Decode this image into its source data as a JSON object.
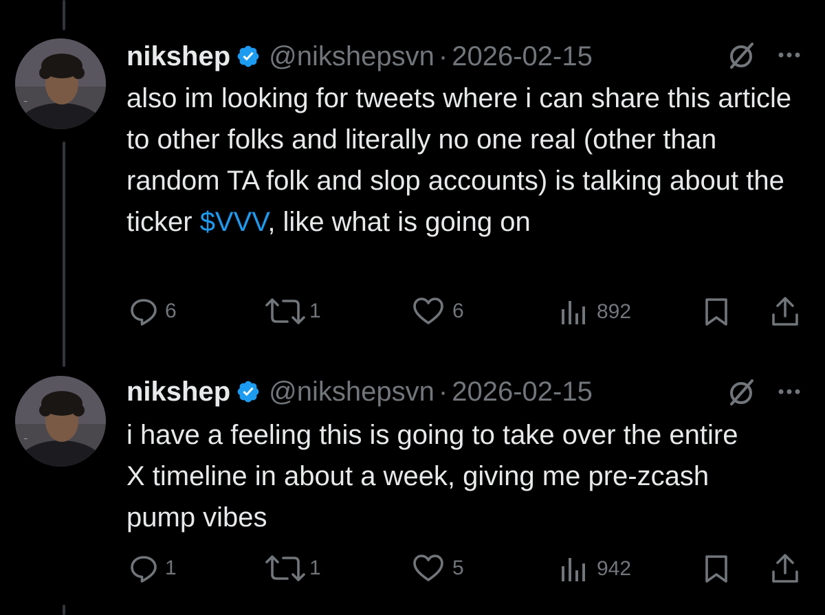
{
  "colors": {
    "background": "#000000",
    "text": "#e7e9ea",
    "muted": "#71767b",
    "accent": "#1d9bf0",
    "thread_line": "#333639"
  },
  "tweets": [
    {
      "author": "nikshep",
      "handle": "@nikshepsvn",
      "separator": "·",
      "date": "2026-02-15",
      "verified_icon": "verified-badge-icon",
      "text_before": "also im looking for tweets where i can share this article to other folks and literally no one real (other than random TA folk and slop accounts) is talking about the ticker ",
      "cashtag": "$VVV",
      "text_after": ", like what is going on",
      "replies": "6",
      "reposts": "1",
      "likes": "6",
      "views": "892"
    },
    {
      "author": "nikshep",
      "handle": "@nikshepsvn",
      "separator": "·",
      "date": "2026-02-15",
      "verified_icon": "verified-badge-icon",
      "text": "i have a feeling this is going to take over the entire X timeline in about a week, giving me pre-zcash pump vibes",
      "replies": "1",
      "reposts": "1",
      "likes": "5",
      "views": "942"
    }
  ]
}
